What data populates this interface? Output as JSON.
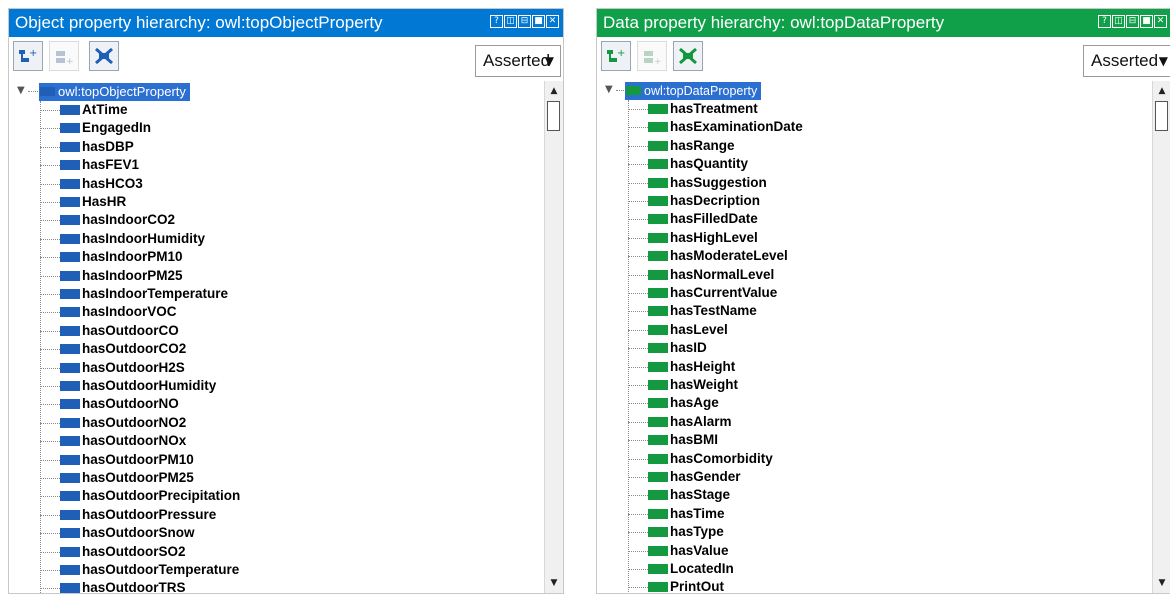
{
  "colors": {
    "object_accent": "#0078d4",
    "data_accent": "#10a04a",
    "object_swatch": "#1f5fb5",
    "data_swatch": "#149840",
    "root_highlight": "#2b6fd0"
  },
  "icons": [
    "add-subproperty-icon",
    "add-sibling-icon",
    "delete-property-icon"
  ],
  "left": {
    "title": "Object property hierarchy: owl:topObjectProperty",
    "dropdown": "Asserted",
    "root": "owl:topObjectProperty",
    "items": [
      "AtTime",
      "EngagedIn",
      "hasDBP",
      "hasFEV1",
      "hasHCO3",
      "HasHR",
      "hasIndoorCO2",
      "hasIndoorHumidity",
      "hasIndoorPM10",
      "hasIndoorPM25",
      "hasIndoorTemperature",
      "hasIndoorVOC",
      "hasOutdoorCO",
      "hasOutdoorCO2",
      "hasOutdoorH2S",
      "hasOutdoorHumidity",
      "hasOutdoorNO",
      "hasOutdoorNO2",
      "hasOutdoorNOx",
      "hasOutdoorPM10",
      "hasOutdoorPM25",
      "hasOutdoorPrecipitation",
      "hasOutdoorPressure",
      "hasOutdoorSnow",
      "hasOutdoorSO2",
      "hasOutdoorTemperature",
      "hasOutdoorTRS"
    ]
  },
  "right": {
    "title": "Data property hierarchy: owl:topDataProperty",
    "dropdown": "Asserted",
    "root": "owl:topDataProperty",
    "items": [
      "hasTreatment",
      "hasExaminationDate",
      "hasRange",
      "hasQuantity",
      "hasSuggestion",
      "hasDecription",
      "hasFilledDate",
      "hasHighLevel",
      "hasModerateLevel",
      "hasNormalLevel",
      "hasCurrentValue",
      "hasTestName",
      "hasLevel",
      "hasID",
      "hasHeight",
      "hasWeight",
      "hasAge",
      "hasAlarm",
      "hasBMI",
      "hasComorbidity",
      "hasGender",
      "hasStage",
      "hasTime",
      "hasType",
      "hasValue",
      "LocatedIn",
      "PrintOut"
    ]
  }
}
